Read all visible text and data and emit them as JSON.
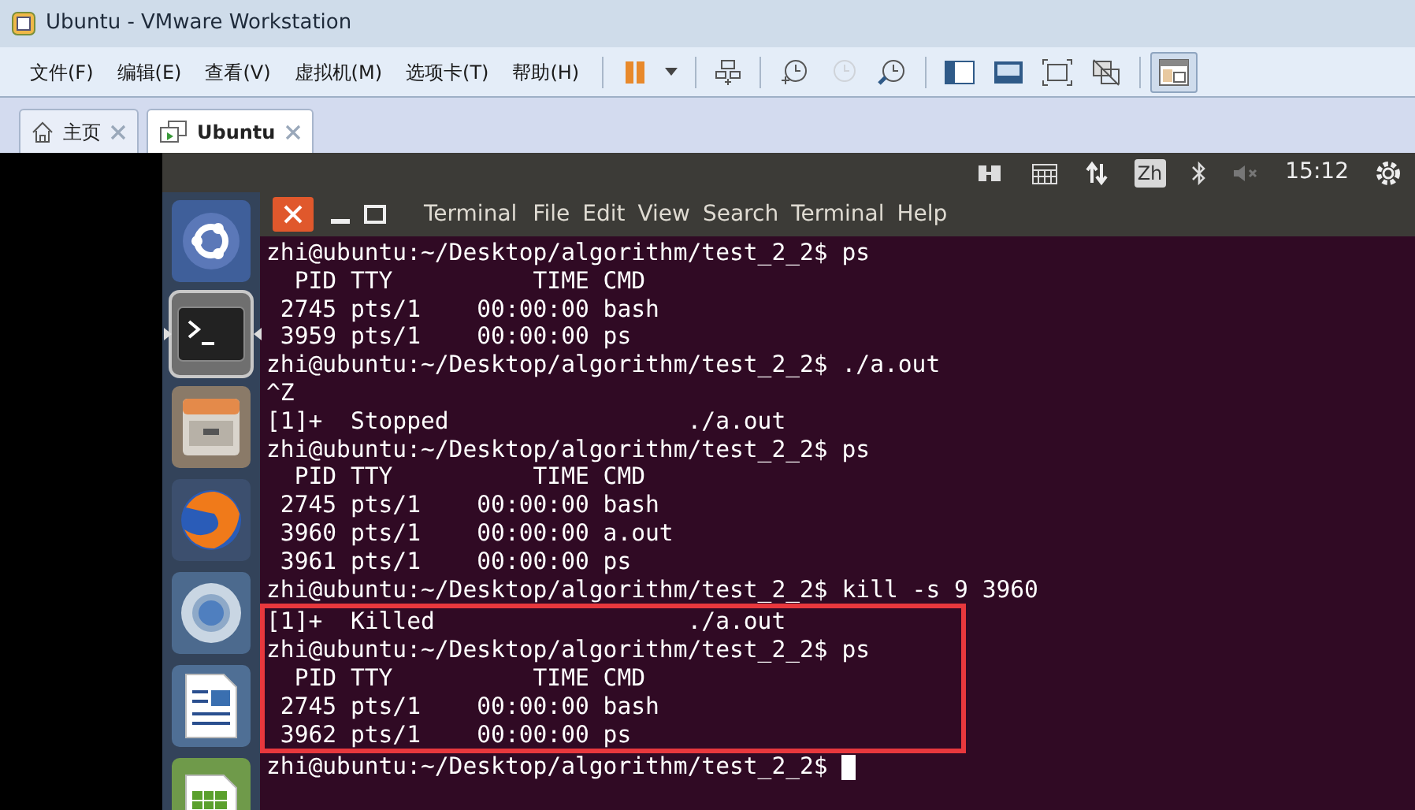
{
  "window": {
    "title": "Ubuntu - VMware Workstation"
  },
  "menu": [
    "文件(F)",
    "编辑(E)",
    "查看(V)",
    "虚拟机(M)",
    "选项卡(T)",
    "帮助(H)"
  ],
  "toolbar_buttons": [
    {
      "pressed": false,
      "disabled": false
    },
    {
      "pressed": false,
      "disabled": false
    },
    {
      "pressed": false,
      "disabled": false
    },
    {
      "pressed": false,
      "disabled": false
    },
    {
      "pressed": false,
      "disabled": true
    },
    {
      "pressed": false,
      "disabled": false
    },
    {
      "pressed": false,
      "disabled": false
    },
    {
      "pressed": false,
      "disabled": false
    },
    {
      "pressed": false,
      "disabled": false
    },
    {
      "pressed": false,
      "disabled": false
    },
    {
      "pressed": true,
      "disabled": false
    }
  ],
  "tabs": [
    {
      "label": "主页",
      "selected": false
    },
    {
      "label": "Ubuntu",
      "selected": true
    }
  ],
  "top_panel": {
    "input_method": "Zh",
    "clock": "15:12"
  },
  "launcher": [
    {
      "active": false
    },
    {
      "active": true
    },
    {
      "active": false
    },
    {
      "active": false
    },
    {
      "active": false
    },
    {
      "active": false
    },
    {
      "active": false
    }
  ],
  "terminal": {
    "title": "Terminal",
    "menu": [
      "File",
      "Edit",
      "View",
      "Search",
      "Terminal",
      "Help"
    ],
    "lines": [
      {
        "text": "zhi@ubuntu:~/Desktop/algorithm/test_2_2$ ps",
        "highlighted": false
      },
      {
        "text": "  PID TTY          TIME CMD",
        "highlighted": false
      },
      {
        "text": " 2745 pts/1    00:00:00 bash",
        "highlighted": false
      },
      {
        "text": " 3959 pts/1    00:00:00 ps",
        "highlighted": false
      },
      {
        "text": "zhi@ubuntu:~/Desktop/algorithm/test_2_2$ ./a.out",
        "highlighted": false
      },
      {
        "text": "^Z",
        "highlighted": false
      },
      {
        "text": "[1]+  Stopped                 ./a.out",
        "highlighted": false
      },
      {
        "text": "zhi@ubuntu:~/Desktop/algorithm/test_2_2$ ps",
        "highlighted": false
      },
      {
        "text": "  PID TTY          TIME CMD",
        "highlighted": false
      },
      {
        "text": " 2745 pts/1    00:00:00 bash",
        "highlighted": false
      },
      {
        "text": " 3960 pts/1    00:00:00 a.out",
        "highlighted": false
      },
      {
        "text": " 3961 pts/1    00:00:00 ps",
        "highlighted": false
      },
      {
        "text": "zhi@ubuntu:~/Desktop/algorithm/test_2_2$ kill -s 9 3960",
        "highlighted": false
      },
      {
        "text": "[1]+  Killed                  ./a.out",
        "highlighted": true
      },
      {
        "text": "zhi@ubuntu:~/Desktop/algorithm/test_2_2$ ps",
        "highlighted": true
      },
      {
        "text": "  PID TTY          TIME CMD",
        "highlighted": true
      },
      {
        "text": " 2745 pts/1    00:00:00 bash",
        "highlighted": true
      },
      {
        "text": " 3962 pts/1    00:00:00 ps",
        "highlighted": true
      },
      {
        "text": "zhi@ubuntu:~/Desktop/algorithm/test_2_2$ ",
        "highlighted": false
      }
    ],
    "cursor": true
  }
}
